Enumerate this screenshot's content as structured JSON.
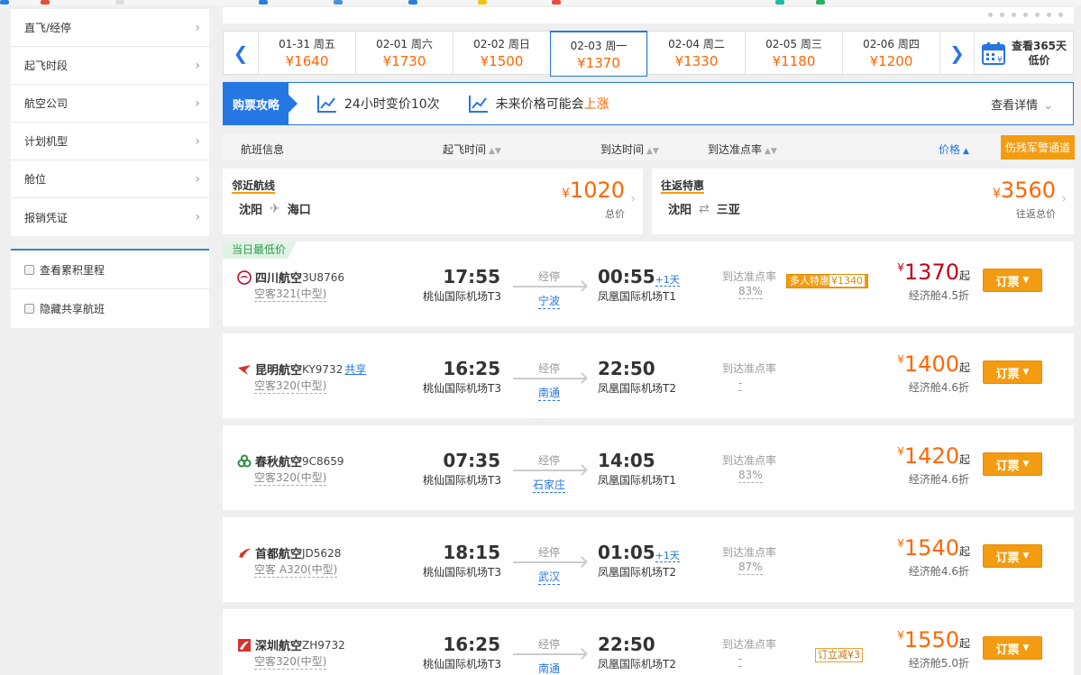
{
  "sidebar": {
    "filters": [
      {
        "label": "直飞/经停"
      },
      {
        "label": "起飞时段"
      },
      {
        "label": "航空公司"
      },
      {
        "label": "计划机型"
      },
      {
        "label": "舱位"
      },
      {
        "label": "报销凭证"
      }
    ],
    "checks": [
      {
        "label": "查看累积里程"
      },
      {
        "label": "隐藏共享航班"
      }
    ]
  },
  "dates": [
    {
      "date": "01-31 周五",
      "price": "¥1640"
    },
    {
      "date": "02-01 周六",
      "price": "¥1730"
    },
    {
      "date": "02-02 周日",
      "price": "¥1500"
    },
    {
      "date": "02-03 周一",
      "price": "¥1370",
      "active": true
    },
    {
      "date": "02-04 周二",
      "price": "¥1330"
    },
    {
      "date": "02-05 周三",
      "price": "¥1180"
    },
    {
      "date": "02-06 周四",
      "price": "¥1200"
    }
  ],
  "calendar": {
    "line1": "查看365天",
    "line2": "低价"
  },
  "tips": {
    "tag": "购票攻略",
    "item1": "24小时变价10次",
    "item2_prefix": "未来价格可能会",
    "item2_highlight": "上涨",
    "detail": "查看详情"
  },
  "sort": {
    "flight_info": "航班信息",
    "dep_time": "起飞时间",
    "arr_time": "到达时间",
    "ontime": "到达准点率",
    "price": "价格",
    "soldier": "伤残军警通道"
  },
  "promos": [
    {
      "title": "邻近航线",
      "from": "沈阳",
      "to": "海口",
      "price": "1020",
      "label": "总价",
      "currency": "¥"
    },
    {
      "title": "往返特惠",
      "from": "沈阳",
      "to": "三亚",
      "price": "3560",
      "label": "往返总价",
      "currency": "¥"
    }
  ],
  "lowest_tag": "当日最低价",
  "flights": [
    {
      "airline": "四川航空",
      "code": "3U8766",
      "share": "",
      "craft": "空客321(中型)",
      "dep": "17:55",
      "dep_airport": "桃仙国际机场T3",
      "stop_label": "经停",
      "stop_city": "宁波",
      "arr": "00:55",
      "plus": "+1天",
      "arr_airport": "凤凰国际机场T1",
      "ontime_label": "到达准点率",
      "ontime": "83%",
      "badge_multi": "多人特惠",
      "badge_multi_price": "¥1340",
      "badge_off": "",
      "currency": "¥",
      "price": "1370",
      "qi": "起",
      "cabin": "经济舱4.5折",
      "book": "订票",
      "color": "#c0001a"
    },
    {
      "airline": "昆明航空",
      "code": "KY9732",
      "share": "共享",
      "craft": "空客320(中型)",
      "dep": "16:25",
      "dep_airport": "桃仙国际机场T3",
      "stop_label": "经停",
      "stop_city": "南通",
      "arr": "22:50",
      "plus": "",
      "arr_airport": "凤凰国际机场T2",
      "ontime_label": "到达准点率",
      "ontime": "-",
      "badge_multi": "",
      "badge_multi_price": "",
      "badge_off": "",
      "currency": "¥",
      "price": "1400",
      "qi": "起",
      "cabin": "经济舱4.6折",
      "book": "订票",
      "color": "#d6322c"
    },
    {
      "airline": "春秋航空",
      "code": "9C8659",
      "share": "",
      "craft": "空客320(中型)",
      "dep": "07:35",
      "dep_airport": "桃仙国际机场T3",
      "stop_label": "经停",
      "stop_city": "石家庄",
      "arr": "14:05",
      "plus": "",
      "arr_airport": "凤凰国际机场T1",
      "ontime_label": "到达准点率",
      "ontime": "83%",
      "badge_multi": "",
      "badge_multi_price": "",
      "badge_off": "",
      "currency": "¥",
      "price": "1420",
      "qi": "起",
      "cabin": "经济舱4.6折",
      "book": "订票",
      "color": "#2e8b3e"
    },
    {
      "airline": "首都航空",
      "code": "JD5628",
      "share": "",
      "craft": "空客 A320(中型)",
      "dep": "18:15",
      "dep_airport": "桃仙国际机场T3",
      "stop_label": "经停",
      "stop_city": "武汉",
      "arr": "01:05",
      "plus": "+1天",
      "arr_airport": "凤凰国际机场T2",
      "ontime_label": "到达准点率",
      "ontime": "87%",
      "badge_multi": "",
      "badge_multi_price": "",
      "badge_off": "",
      "currency": "¥",
      "price": "1540",
      "qi": "起",
      "cabin": "经济舱4.6折",
      "book": "订票",
      "color": "#d6322c"
    },
    {
      "airline": "深圳航空",
      "code": "ZH9732",
      "share": "",
      "craft": "空客320(中型)",
      "dep": "16:25",
      "dep_airport": "桃仙国际机场T3",
      "stop_label": "经停",
      "stop_city": "南通",
      "arr": "22:50",
      "plus": "",
      "arr_airport": "凤凰国际机场T2",
      "ontime_label": "到达准点率",
      "ontime": "-",
      "badge_multi": "",
      "badge_multi_price": "",
      "badge_off": "订立减¥3",
      "currency": "¥",
      "price": "1550",
      "qi": "起",
      "cabin": "经济舱5.0折",
      "book": "订票",
      "color": "#d6322c"
    }
  ]
}
